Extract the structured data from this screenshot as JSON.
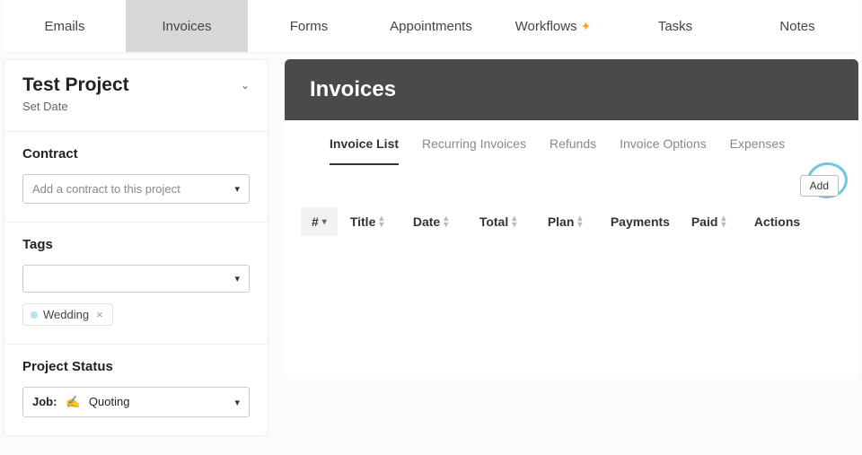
{
  "topbar": {
    "tabs": [
      {
        "label": "Emails"
      },
      {
        "label": "Invoices",
        "active": true
      },
      {
        "label": "Forms"
      },
      {
        "label": "Appointments"
      },
      {
        "label": "Workflows",
        "sparkle": true
      },
      {
        "label": "Tasks"
      },
      {
        "label": "Notes"
      }
    ]
  },
  "sidebar": {
    "project_title": "Test Project",
    "set_date": "Set Date",
    "contract": {
      "heading": "Contract",
      "placeholder": "Add a contract to this project"
    },
    "tags": {
      "heading": "Tags",
      "selected_placeholder": "",
      "chip": "Wedding"
    },
    "status": {
      "heading": "Project Status",
      "job_label": "Job:",
      "job_value": "Quoting"
    }
  },
  "main": {
    "header": "Invoices",
    "subtabs": {
      "invoice_list": "Invoice List",
      "recurring": "Recurring Invoices",
      "refunds": "Refunds",
      "options": "Invoice Options",
      "expenses": "Expenses"
    },
    "add_label": "Add",
    "columns": {
      "hash": "#",
      "title": "Title",
      "date": "Date",
      "total": "Total",
      "plan": "Plan",
      "payments": "Payments",
      "paid": "Paid",
      "actions": "Actions"
    }
  }
}
